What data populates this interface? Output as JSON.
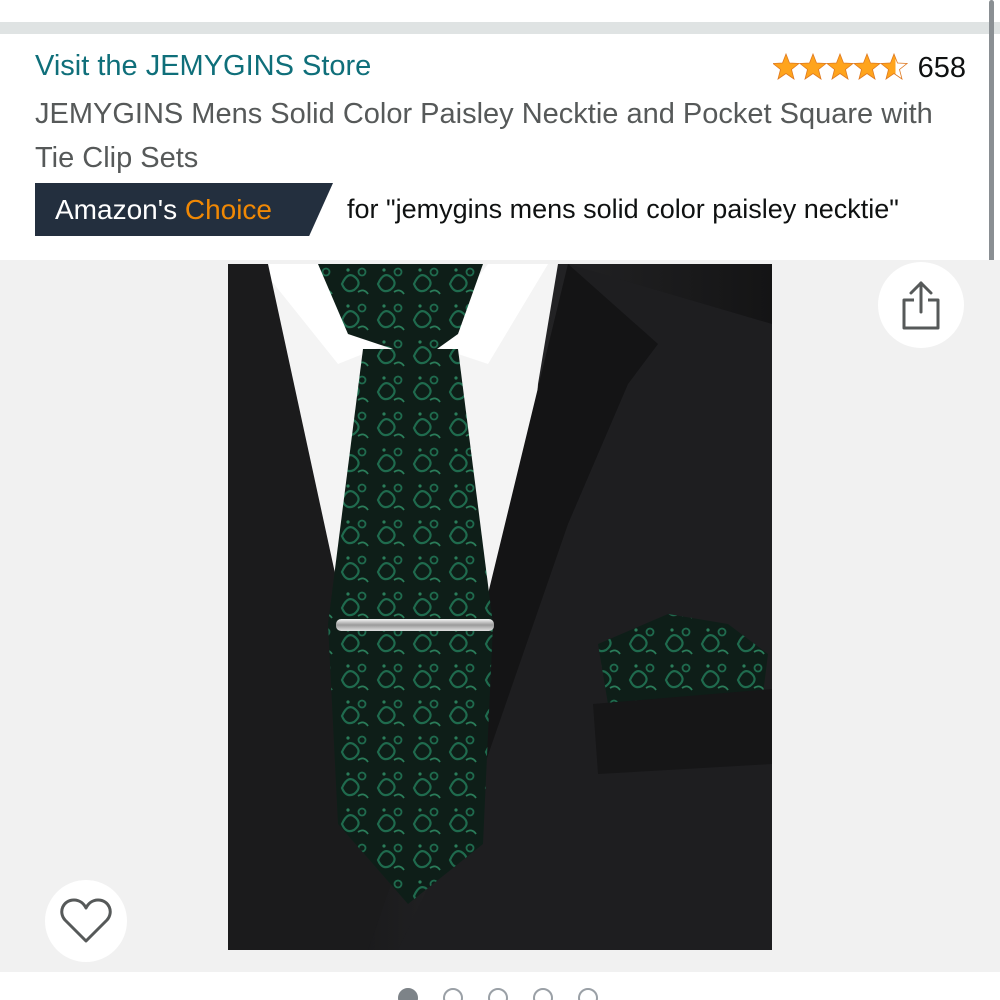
{
  "store": {
    "link_text": "Visit the JEMYGINS Store",
    "color": "#0f6f7a"
  },
  "rating": {
    "stars": 4.5,
    "count": "658",
    "star_color": "#ffa41c"
  },
  "product": {
    "title": "JEMYGINS Mens Solid Color Paisley Necktie and Pocket Square with Tie Clip Sets"
  },
  "badge": {
    "amazons": "Amazon's",
    "choice": "Choice",
    "query_text": "for \"jemygins mens solid color paisley necktie\"",
    "background": "#232f3e",
    "accent": "#f08804"
  },
  "image": {
    "share_icon": "share-icon",
    "heart_icon": "heart-icon",
    "carousel": {
      "total": 5,
      "active": 1
    }
  }
}
